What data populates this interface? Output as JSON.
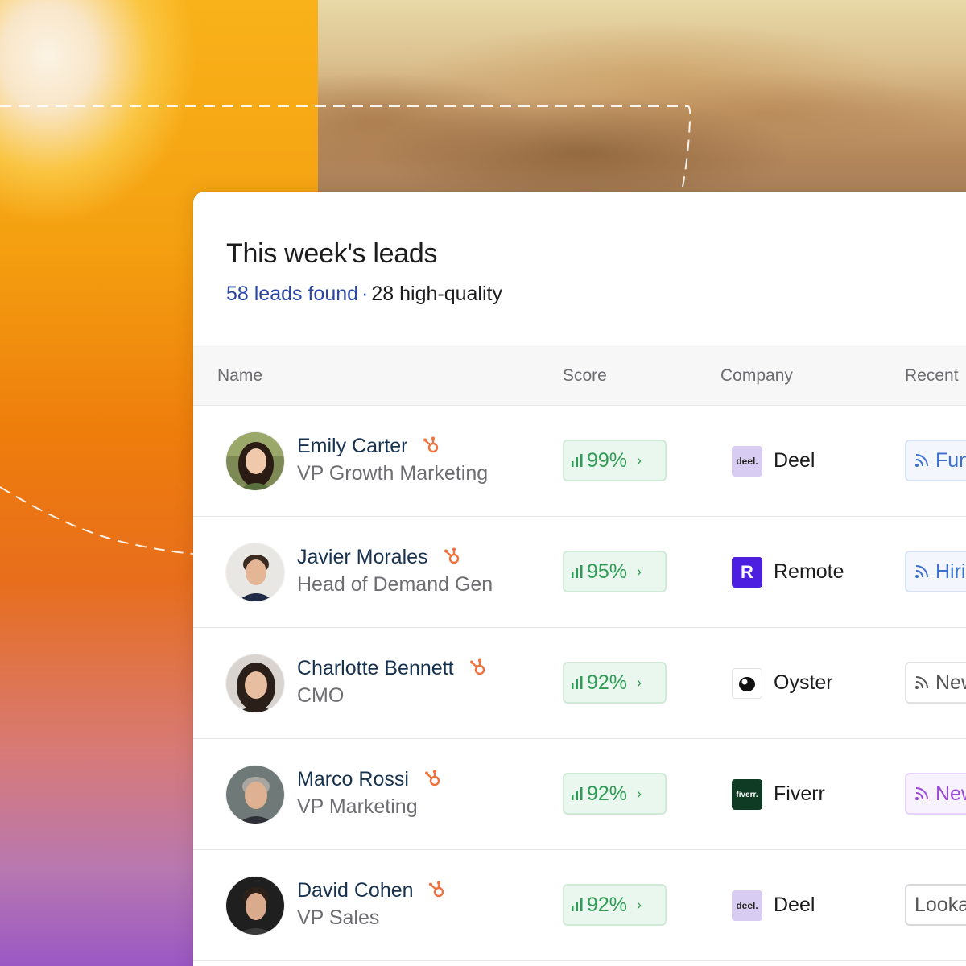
{
  "card": {
    "title": "This week's leads",
    "leads_found": "58 leads found",
    "separator": "·",
    "high_quality": "28 high-quality"
  },
  "table": {
    "columns": [
      "Name",
      "Score",
      "Company",
      "Recent"
    ],
    "rows": [
      {
        "name": "Emily Carter",
        "title": "VP Growth Marketing",
        "score": "99%",
        "company": "Deel",
        "logo_text": "deel.",
        "recent": "Fun",
        "recent_style": "blue"
      },
      {
        "name": "Javier Morales",
        "title": "Head of Demand Gen",
        "score": "95%",
        "company": "Remote",
        "logo_text": "R",
        "recent": "Hiri",
        "recent_style": "blue"
      },
      {
        "name": "Charlotte Bennett",
        "title": "CMO",
        "score": "92%",
        "company": "Oyster",
        "logo_text": "",
        "recent": "New",
        "recent_style": "gray"
      },
      {
        "name": "Marco Rossi",
        "title": "VP Marketing",
        "score": "92%",
        "company": "Fiverr",
        "logo_text": "fiverr.",
        "recent": "New",
        "recent_style": "purple"
      },
      {
        "name": "David Cohen",
        "title": "VP Sales",
        "score": "92%",
        "company": "Deel",
        "logo_text": "deel.",
        "recent": "Looka",
        "recent_style": "plain"
      }
    ]
  },
  "colors": {
    "accent": "#2a46a6",
    "score_green": "#2f9c55",
    "hubspot_orange": "#f0703e",
    "recent_blue": "#3b6fd0",
    "recent_purple": "#9b48d8"
  },
  "icons": {
    "crm": "hubspot-sprocket-icon",
    "score": "signal-bars-icon",
    "chevron": "chevron-right-icon",
    "feed": "rss-feed-icon"
  }
}
